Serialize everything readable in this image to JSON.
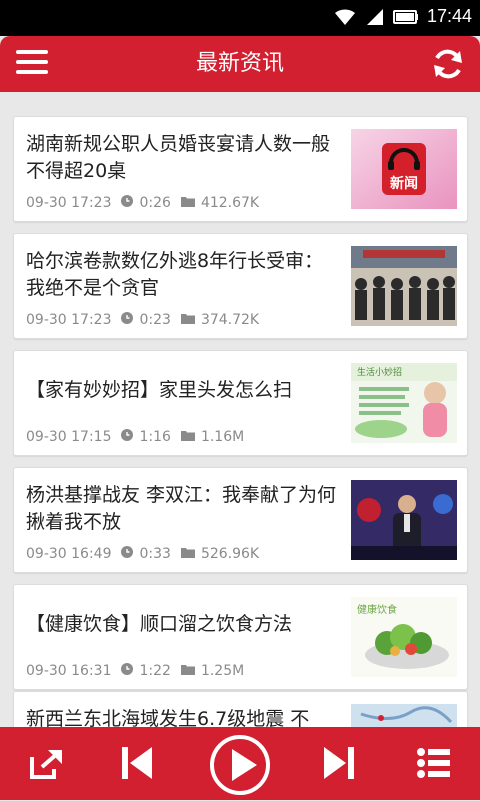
{
  "statusbar": {
    "time": "17:44"
  },
  "header": {
    "title": "最新资讯"
  },
  "news": [
    {
      "title": "湖南新规公职人员婚丧宴请人数一般不得超20桌",
      "date": "09-30 17:23",
      "duration": "0:26",
      "size": "412.67K"
    },
    {
      "title": "哈尔滨卷款数亿外逃8年行长受审：我绝不是个贪官",
      "date": "09-30 17:23",
      "duration": "0:23",
      "size": "374.72K"
    },
    {
      "title": "【家有妙妙招】家里头发怎么扫",
      "date": "09-30 17:15",
      "duration": "1:16",
      "size": "1.16M"
    },
    {
      "title": "杨洪基撑战友 李双江：我奉献了为何揪着我不放",
      "date": "09-30 16:49",
      "duration": "0:33",
      "size": "526.96K"
    },
    {
      "title": "【健康饮食】顺口溜之饮食方法",
      "date": "09-30 16:31",
      "duration": "1:22",
      "size": "1.25M"
    },
    {
      "title": "新西兰东北海域发生6.7级地震 不"
    }
  ],
  "thumbs": {
    "news_logo_text": "新闻",
    "tips_text1": "生活小妙招",
    "food_text": "健康饮食"
  },
  "colors": {
    "accent": "#d22030"
  }
}
